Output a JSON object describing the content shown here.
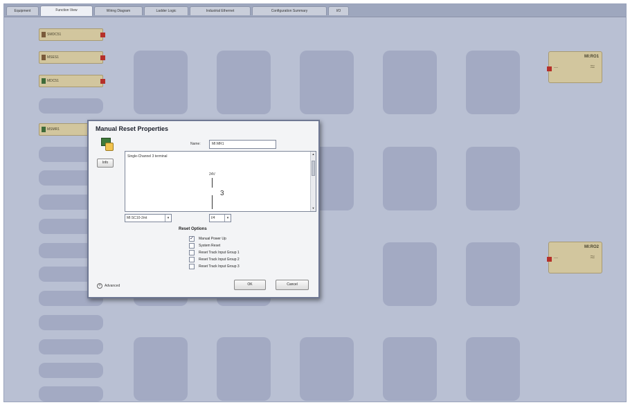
{
  "tabs": [
    "Equipment",
    "Function View",
    "Wiring Diagram",
    "Ladder Logic",
    "Industrial Ethernet",
    "Configuration Summary",
    "I/O"
  ],
  "active_tab": "Function View",
  "input_blocks": [
    {
      "label": "SMDC51",
      "icon": "device-icon"
    },
    {
      "label": "MSES1",
      "icon": "device-icon"
    },
    {
      "label": "MDC51",
      "icon": "device-icon"
    },
    {
      "label": "MSMR1",
      "icon": "device-icon"
    }
  ],
  "output_blocks": [
    {
      "label": "MI:RO1"
    },
    {
      "label": "MI:RO2"
    }
  ],
  "dialog": {
    "title": "Manual Reset Properties",
    "info_button": "Info",
    "name_label": "Name:",
    "name_value": "MI:MR1",
    "preview": {
      "description": "Single-Channel 3 terminal",
      "voltage": "24V",
      "terminal_number": "3"
    },
    "terminal_select": "MI:SC10-2mt",
    "io_select": "I/4",
    "reset_options_label": "Reset Options",
    "reset_options": [
      {
        "label": "Manual Power Up",
        "checked": true
      },
      {
        "label": "System Reset",
        "checked": false
      },
      {
        "label": "Reset Track Input Group 1",
        "checked": false
      },
      {
        "label": "Reset Track Input Group 2",
        "checked": false
      },
      {
        "label": "Reset Track Input Group 3",
        "checked": false
      }
    ],
    "advanced_label": "Advanced",
    "ok_button": "OK",
    "cancel_button": "Cancel"
  },
  "colors": {
    "canvas_bg": "#b9c0d3",
    "tile": "#a3aac3",
    "block": "#d2c69e",
    "pin": "#b5302a"
  }
}
